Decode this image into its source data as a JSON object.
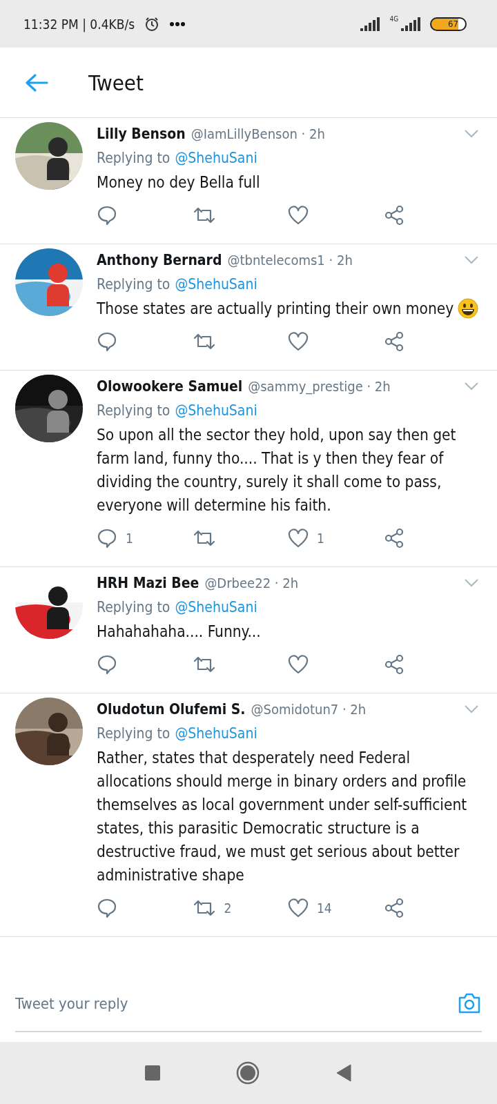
{
  "status_bar": {
    "time": "11:32 PM | 0.4KB/s",
    "network": "4G",
    "battery": "67"
  },
  "header": {
    "title": "Tweet"
  },
  "tweets": [
    {
      "name": "Lilly Benson",
      "handle": "@IamLillyBenson · 2h",
      "replying_label": "Replying to",
      "replying_to": "@ShehuSani",
      "text": "Money no dey Bella full",
      "emoji": false
    },
    {
      "name": "Anthony Bernard",
      "handle": "@tbntelecoms1 · 2h",
      "replying_label": "Replying to",
      "replying_to": "@ShehuSani",
      "text": "Those states are actually printing their own money",
      "emoji": true
    },
    {
      "name": "Olowookere Samuel",
      "handle": "@sammy_prestige · 2h",
      "replying_label": "Replying to",
      "replying_to": "@ShehuSani",
      "text": "So upon all the sector they hold, upon say then get farm land, funny tho.... That is y then they fear of dividing the country, surely it shall come to pass, everyone will determine his faith.",
      "emoji": false,
      "reply_count": "1",
      "like_count": "1"
    },
    {
      "name": "HRH Mazi Bee",
      "handle": "@Drbee22 · 2h",
      "replying_label": "Replying to",
      "replying_to": "@ShehuSani",
      "text": "Hahahahaha.... Funny...",
      "emoji": false
    },
    {
      "name": "Oludotun Olufemi S.",
      "handle": "@Somidotun7 · 2h",
      "replying_label": "Replying to",
      "replying_to": "@ShehuSani",
      "text": "Rather, states that desperately need Federal allocations should merge in binary orders and profile themselves as local government under self-sufficient states, this parasitic Democratic structure is a destructive fraud, we must get serious about better administrative shape",
      "emoji": false,
      "retweet_count": "2",
      "like_count": "14"
    }
  ],
  "reply_bar": {
    "placeholder": "Tweet your reply"
  }
}
